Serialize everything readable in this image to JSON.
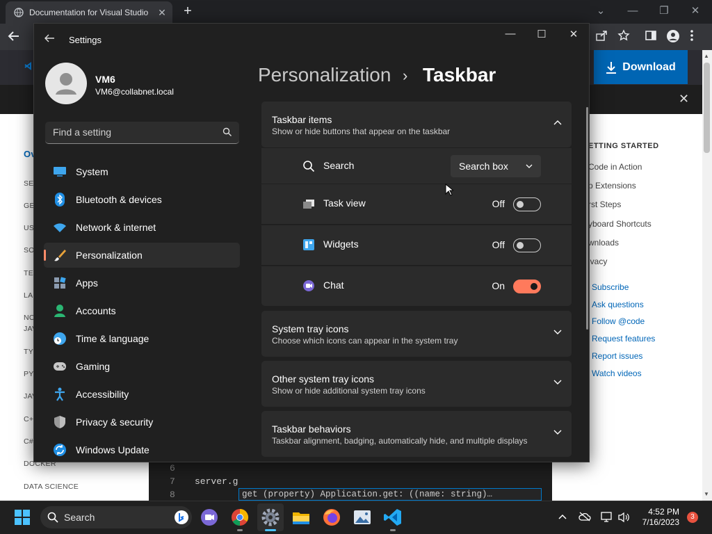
{
  "browser": {
    "tab_title": "Documentation for Visual Studio",
    "tab_close": "✕",
    "new_tab": "+",
    "window_controls": [
      "⌄",
      "—",
      "❐",
      "✕"
    ]
  },
  "webpage": {
    "download_label": "Download",
    "left_nav": [
      "Ov",
      "SE",
      "GE",
      "US",
      "SO",
      "TE",
      "LA",
      "NO",
      "JAV",
      "TY",
      "PY",
      "JAV",
      "C+",
      "C#",
      "DOCKER",
      "DATA SCIENCE"
    ],
    "getting_started": {
      "heading": "ETTING STARTED",
      "items": [
        "Code in Action",
        "p Extensions",
        "rst Steps",
        "yboard Shortcuts",
        "wnloads",
        "ivacy"
      ]
    },
    "links": [
      "Subscribe",
      "Ask questions",
      "Follow @code",
      "Request features",
      "Report issues",
      "Watch videos"
    ],
    "code": {
      "line6": "6",
      "line7": "7",
      "line8": "8",
      "code7": "server.g",
      "hint": "get (property) Application.get: ((name: string)…"
    }
  },
  "settings": {
    "title": "Settings",
    "user_name": "VM6",
    "user_email": "VM6@collabnet.local",
    "search_placeholder": "Find a setting",
    "nav": [
      {
        "label": "System",
        "icon": "monitor-icon"
      },
      {
        "label": "Bluetooth & devices",
        "icon": "bluetooth-icon"
      },
      {
        "label": "Network & internet",
        "icon": "wifi-icon"
      },
      {
        "label": "Personalization",
        "icon": "brush-icon",
        "selected": true
      },
      {
        "label": "Apps",
        "icon": "apps-icon"
      },
      {
        "label": "Accounts",
        "icon": "person-icon"
      },
      {
        "label": "Time & language",
        "icon": "globe-clock-icon"
      },
      {
        "label": "Gaming",
        "icon": "gamepad-icon"
      },
      {
        "label": "Accessibility",
        "icon": "accessibility-icon"
      },
      {
        "label": "Privacy & security",
        "icon": "shield-icon"
      },
      {
        "label": "Windows Update",
        "icon": "update-icon"
      }
    ],
    "breadcrumb": {
      "parent": "Personalization",
      "separator": "›",
      "current": "Taskbar"
    },
    "taskbar_items": {
      "title": "Taskbar items",
      "subtitle": "Show or hide buttons that appear on the taskbar",
      "rows": {
        "search": {
          "label": "Search",
          "value": "Search box"
        },
        "task_view": {
          "label": "Task view",
          "state": "Off",
          "on": false
        },
        "widgets": {
          "label": "Widgets",
          "state": "Off",
          "on": false
        },
        "chat": {
          "label": "Chat",
          "state": "On",
          "on": true
        }
      }
    },
    "sections": [
      {
        "title": "System tray icons",
        "subtitle": "Choose which icons can appear in the system tray"
      },
      {
        "title": "Other system tray icons",
        "subtitle": "Show or hide additional system tray icons"
      },
      {
        "title": "Taskbar behaviors",
        "subtitle": "Taskbar alignment, badging, automatically hide, and multiple displays"
      }
    ]
  },
  "taskbar": {
    "search_label": "Search",
    "time": "4:52 PM",
    "date": "7/16/2023",
    "notification_count": "3"
  },
  "colors": {
    "accent": "#ff7a5c",
    "download_blue": "#0065b3",
    "link_blue": "#0066b8"
  }
}
